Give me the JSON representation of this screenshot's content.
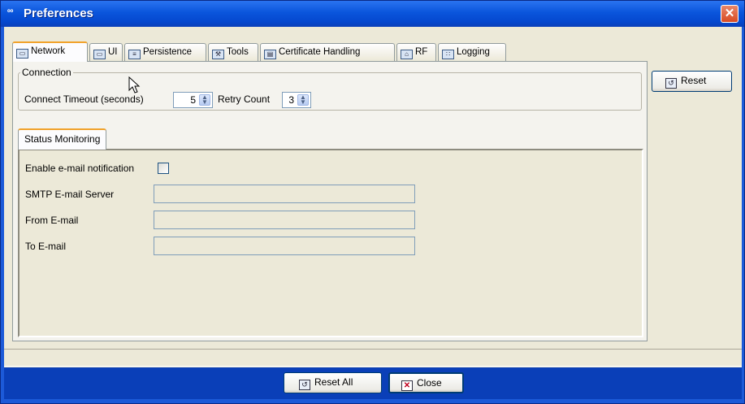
{
  "window": {
    "title": "Preferences"
  },
  "tabs": [
    {
      "label": "Network",
      "icon": "network-icon"
    },
    {
      "label": "UI",
      "icon": "ui-icon"
    },
    {
      "label": "Persistence",
      "icon": "persistence-icon"
    },
    {
      "label": "Tools",
      "icon": "tools-icon"
    },
    {
      "label": "Certificate Handling",
      "icon": "certificate-icon"
    },
    {
      "label": "RF",
      "icon": "rf-icon"
    },
    {
      "label": "Logging",
      "icon": "logging-icon"
    }
  ],
  "connection": {
    "legend": "Connection",
    "timeout_label": "Connect Timeout (seconds)",
    "timeout_value": "5",
    "retry_label": "Retry Count",
    "retry_value": "3"
  },
  "reset_button": "Reset",
  "status_monitoring": {
    "tab_label": "Status Monitoring",
    "email_notification_label": "Enable e-mail notification",
    "email_notification_checked": false,
    "smtp_label": "SMTP E-mail Server",
    "smtp_value": "",
    "from_label": "From E-mail",
    "from_value": "",
    "to_label": "To E-mail",
    "to_value": ""
  },
  "footer": {
    "reset_all": "Reset All",
    "close": "Close"
  },
  "colors": {
    "titlebar": "#0a55dc",
    "active_tab_accent": "#f1a22a",
    "dialog_bg": "#ece9d8"
  }
}
